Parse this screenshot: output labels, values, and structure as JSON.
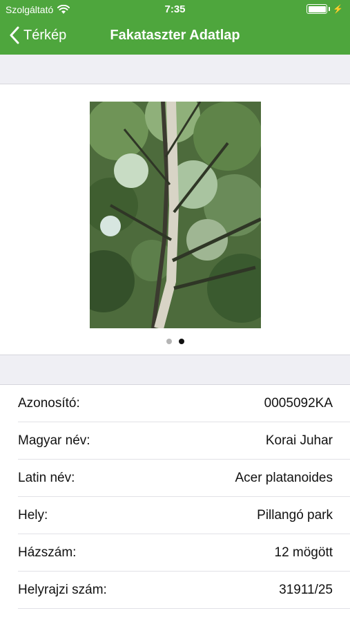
{
  "status_bar": {
    "carrier": "Szolgáltató",
    "time": "7:35"
  },
  "nav": {
    "back_label": "Térkép",
    "title": "Fakataszter Adatlap"
  },
  "gallery": {
    "pages": 2,
    "current_page": 2
  },
  "details": [
    {
      "label": "Azonosító:",
      "value": "0005092KA"
    },
    {
      "label": "Magyar név:",
      "value": "Korai Juhar"
    },
    {
      "label": "Latin név:",
      "value": "Acer platanoides"
    },
    {
      "label": "Hely:",
      "value": "Pillangó park"
    },
    {
      "label": "Házszám:",
      "value": "12 mögött"
    },
    {
      "label": "Helyrajzi szám:",
      "value": "31911/25"
    }
  ],
  "colors": {
    "accent": "#4ea63d",
    "section_background": "#efeff4"
  }
}
